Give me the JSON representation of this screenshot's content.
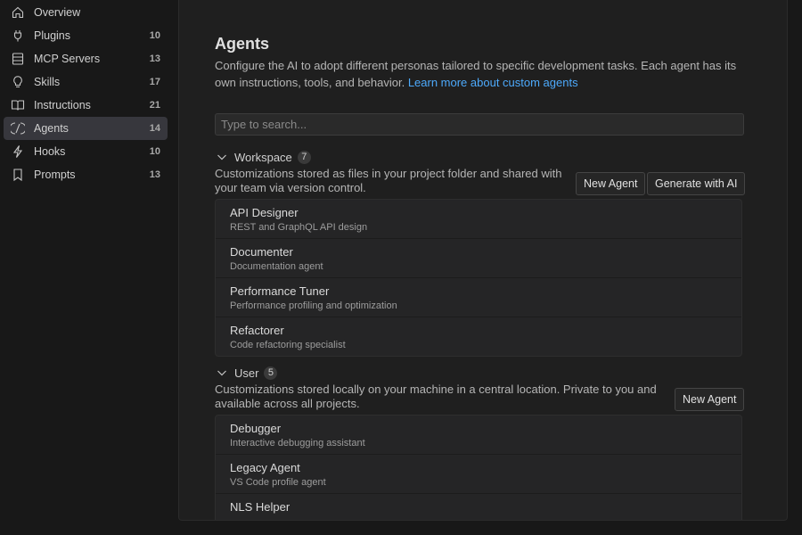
{
  "sidebar": {
    "items": [
      {
        "label": "Overview",
        "count": "",
        "icon": "home-icon"
      },
      {
        "label": "Plugins",
        "count": "10",
        "icon": "plug-icon"
      },
      {
        "label": "MCP Servers",
        "count": "13",
        "icon": "server-icon"
      },
      {
        "label": "Skills",
        "count": "17",
        "icon": "lightbulb-icon"
      },
      {
        "label": "Instructions",
        "count": "21",
        "icon": "book-icon"
      },
      {
        "label": "Agents",
        "count": "14",
        "icon": "agent-icon"
      },
      {
        "label": "Hooks",
        "count": "10",
        "icon": "lightning-icon"
      },
      {
        "label": "Prompts",
        "count": "13",
        "icon": "bookmark-icon"
      }
    ],
    "active": "Agents"
  },
  "main": {
    "title": "Agents",
    "description": "Configure the AI to adopt different personas tailored to specific development tasks. Each agent has its own instructions, tools, and behavior.",
    "learn_more": "Learn more about custom agents",
    "search_placeholder": "Type to search...",
    "groups": [
      {
        "name": "Workspace",
        "count": "7",
        "description": "Customizations stored as files in your project folder and shared with your team via version control.",
        "new_button": "New Agent",
        "generate_button": "Generate with AI",
        "items": [
          {
            "name": "API Designer",
            "desc": "REST and GraphQL API design"
          },
          {
            "name": "Documenter",
            "desc": "Documentation agent"
          },
          {
            "name": "Performance Tuner",
            "desc": "Performance profiling and optimization"
          },
          {
            "name": "Refactorer",
            "desc": "Code refactoring specialist"
          }
        ]
      },
      {
        "name": "User",
        "count": "5",
        "description": "Customizations stored locally on your machine in a central location. Private to you and available across all projects.",
        "new_button": "New Agent",
        "items": [
          {
            "name": "Debugger",
            "desc": "Interactive debugging assistant"
          },
          {
            "name": "Legacy Agent",
            "desc": "VS Code profile agent"
          },
          {
            "name": "NLS Helper",
            "desc": ""
          }
        ]
      }
    ]
  }
}
